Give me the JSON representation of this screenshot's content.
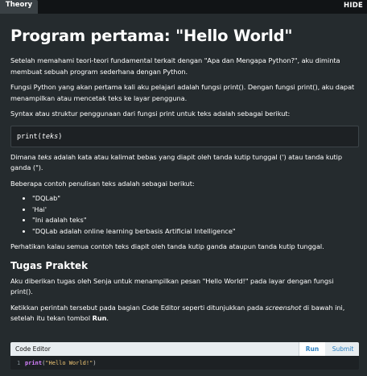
{
  "tabs": {
    "theory_label": "Theory",
    "hide_label": "HIDE"
  },
  "title": "Program pertama: \"Hello World\"",
  "paragraphs": {
    "intro": "Setelah memahami teori-teori fundamental terkait dengan \"Apa dan Mengapa Python?\", aku diminta membuat sebuah program sederhana dengan Python.",
    "print_func": "Fungsi Python yang akan pertama kali aku pelajari adalah fungsi print(). Dengan fungsi print(), aku dapat menampilkan atau mencetak teks ke layar pengguna.",
    "syntax_intro": "Syntax atau struktur penggunaan dari fungsi print untuk teks adalah sebagai berikut:",
    "teks_pre": "Dimana ",
    "teks_word": "teks",
    "teks_post": " adalah kata atau kalimat bebas yang diapit oleh tanda kutip tunggal (') atau tanda kutip ganda (\").",
    "examples_intro": "Beberapa contoh penulisan teks adalah sebagai berikut:",
    "note": "Perhatikan kalau semua contoh teks diapit oleh tanda kutip ganda ataupun tanda kutip tunggal.",
    "task": "Aku diberikan tugas oleh Senja untuk menampilkan pesan \"Hello World!\" pada layar dengan fungsi print().",
    "instr_pre": "Ketikkan perintah tersebut pada bagian Code Editor seperti ditunjukkan pada ",
    "instr_em": "screenshot",
    "instr_mid": " di bawah ini, setelah itu tekan tombol ",
    "instr_bold": "Run",
    "instr_end": "."
  },
  "syntax_code": {
    "func": "print(",
    "arg": "teks",
    "close": ")"
  },
  "examples": [
    "\"DQLab\"",
    "'Hai'",
    "\"Ini adalah teks\"",
    "\"DQLab adalah online learning berbasis Artificial Intelligence\""
  ],
  "section_heading": "Tugas Praktek",
  "editor": {
    "title": "Code Editor",
    "run_label": "Run",
    "submit_label": "Submit",
    "line_number": "1",
    "code_keyword": "print",
    "code_open": "(",
    "code_string": "\"Hello World!\"",
    "code_close": ")"
  },
  "colors": {
    "background": "#252b2e",
    "topbar": "#111416",
    "button_text": "#2a7fc1",
    "keyword": "#d780ff",
    "string": "#f0c674"
  }
}
